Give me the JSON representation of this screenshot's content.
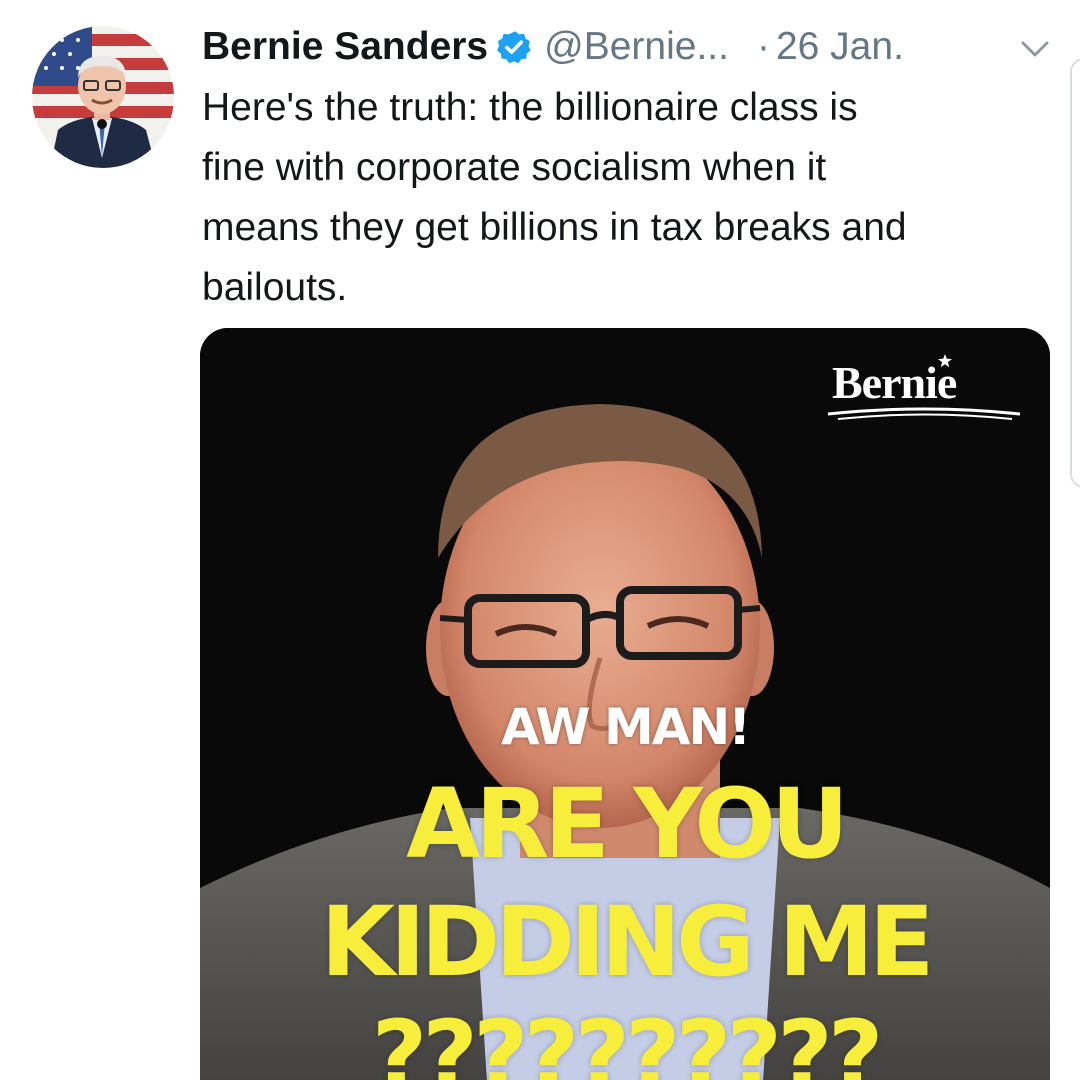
{
  "tweet": {
    "author_name": "Bernie Sanders",
    "handle": "@Bernie...",
    "separator": "·",
    "date": "26 Jan.",
    "text_lines": [
      "Here's the truth: the billionaire class is",
      "fine with corporate socialism when it",
      "means they get billions in tax breaks and",
      "bailouts."
    ]
  },
  "media": {
    "logo_text": "Bernie",
    "caption_top": "AW MAN!",
    "caption_lines": [
      "ARE YOU",
      "KIDDING ME",
      "??????????"
    ]
  },
  "icons": {
    "verified": "verified-badge-icon",
    "menu": "chevron-down-icon"
  },
  "colors": {
    "text_primary": "#14171a",
    "text_secondary": "#657786",
    "verified_blue": "#1da1f2",
    "caption_yellow": "#f7ee3b",
    "media_background": "#090909"
  }
}
